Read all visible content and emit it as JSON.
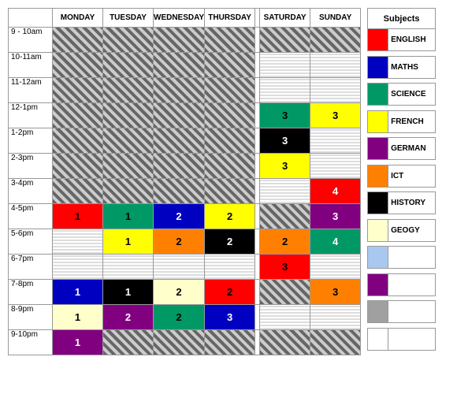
{
  "days": [
    "MONDAY",
    "TUESDAY",
    "WEDNESDAY",
    "THURSDAY",
    "SATURDAY",
    "SUNDAY"
  ],
  "times": [
    "9 - 10am",
    "10-11am",
    "11-12am",
    "12-1pm",
    "1-2pm",
    "2-3pm",
    "3-4pm",
    "4-5pm",
    "5-6pm",
    "6-7pm",
    "7-8pm",
    "8-9pm",
    "9-10pm"
  ],
  "legend_title": "Subjects",
  "subjects": [
    {
      "name": "ENGLISH",
      "color": "#ff0000"
    },
    {
      "name": "MATHS",
      "color": "#0000c0"
    },
    {
      "name": "SCIENCE",
      "color": "#009966"
    },
    {
      "name": "FRENCH",
      "color": "#ffff00"
    },
    {
      "name": "GERMAN",
      "color": "#800080"
    },
    {
      "name": "ICT",
      "color": "#ff8000"
    },
    {
      "name": "HISTORY",
      "color": "#000000"
    },
    {
      "name": "GEOGY",
      "color": "#ffffcc"
    }
  ],
  "extra_swatches": [
    "#a8c8f0",
    "#800080",
    "#a0a0a0",
    "#ffffff"
  ],
  "grid": [
    [
      {
        "t": "hatch"
      },
      {
        "t": "hatch"
      },
      {
        "t": "hatch"
      },
      {
        "t": "hatch"
      },
      {
        "t": "hatch"
      },
      {
        "t": "hatch"
      }
    ],
    [
      {
        "t": "hatch"
      },
      {
        "t": "hatch"
      },
      {
        "t": "hatch"
      },
      {
        "t": "hatch"
      },
      {
        "t": "stripe"
      },
      {
        "t": "stripe"
      }
    ],
    [
      {
        "t": "hatch"
      },
      {
        "t": "hatch"
      },
      {
        "t": "hatch"
      },
      {
        "t": "hatch"
      },
      {
        "t": "stripe"
      },
      {
        "t": "stripe"
      }
    ],
    [
      {
        "t": "hatch"
      },
      {
        "t": "hatch"
      },
      {
        "t": "hatch"
      },
      {
        "t": "hatch"
      },
      {
        "c": "#009966",
        "v": "3"
      },
      {
        "c": "#ffff00",
        "v": "3"
      }
    ],
    [
      {
        "t": "hatch"
      },
      {
        "t": "hatch"
      },
      {
        "t": "hatch"
      },
      {
        "t": "hatch"
      },
      {
        "c": "#000000",
        "v": "3",
        "fg": "#fff"
      },
      {
        "t": "stripe"
      }
    ],
    [
      {
        "t": "hatch"
      },
      {
        "t": "hatch"
      },
      {
        "t": "hatch"
      },
      {
        "t": "hatch"
      },
      {
        "c": "#ffff00",
        "v": "3"
      },
      {
        "t": "stripe"
      }
    ],
    [
      {
        "t": "hatch"
      },
      {
        "t": "hatch"
      },
      {
        "t": "hatch"
      },
      {
        "t": "hatch"
      },
      {
        "t": "stripe"
      },
      {
        "c": "#ff0000",
        "v": "4",
        "fg": "#fff"
      }
    ],
    [
      {
        "c": "#ff0000",
        "v": "1"
      },
      {
        "c": "#009966",
        "v": "1"
      },
      {
        "c": "#0000c0",
        "v": "2",
        "fg": "#fff"
      },
      {
        "c": "#ffff00",
        "v": "2"
      },
      {
        "t": "hatch"
      },
      {
        "c": "#800080",
        "v": "3",
        "fg": "#fff"
      }
    ],
    [
      {
        "t": "stripe"
      },
      {
        "c": "#ffff00",
        "v": "1"
      },
      {
        "c": "#ff8000",
        "v": "2"
      },
      {
        "c": "#000000",
        "v": "2",
        "fg": "#fff"
      },
      {
        "c": "#ff8000",
        "v": "2"
      },
      {
        "c": "#009966",
        "v": "4",
        "fg": "#fff"
      }
    ],
    [
      {
        "t": "stripe"
      },
      {
        "t": "stripe"
      },
      {
        "t": "stripe"
      },
      {
        "t": "stripe"
      },
      {
        "c": "#ff0000",
        "v": "3"
      },
      {
        "t": "stripe"
      }
    ],
    [
      {
        "c": "#0000c0",
        "v": "1",
        "fg": "#fff"
      },
      {
        "c": "#000000",
        "v": "1",
        "fg": "#fff"
      },
      {
        "c": "#ffffcc",
        "v": "2"
      },
      {
        "c": "#ff0000",
        "v": "2"
      },
      {
        "t": "hatch"
      },
      {
        "c": "#ff8000",
        "v": "3"
      }
    ],
    [
      {
        "c": "#ffffcc",
        "v": "1"
      },
      {
        "c": "#800080",
        "v": "2",
        "fg": "#fff"
      },
      {
        "c": "#009966",
        "v": "2"
      },
      {
        "c": "#0000c0",
        "v": "3",
        "fg": "#fff"
      },
      {
        "t": "stripe"
      },
      {
        "t": "stripe"
      }
    ],
    [
      {
        "c": "#800080",
        "v": "1",
        "fg": "#fff"
      },
      {
        "t": "hatch"
      },
      {
        "t": "hatch"
      },
      {
        "t": "hatch"
      },
      {
        "t": "hatch"
      },
      {
        "t": "hatch"
      }
    ]
  ]
}
